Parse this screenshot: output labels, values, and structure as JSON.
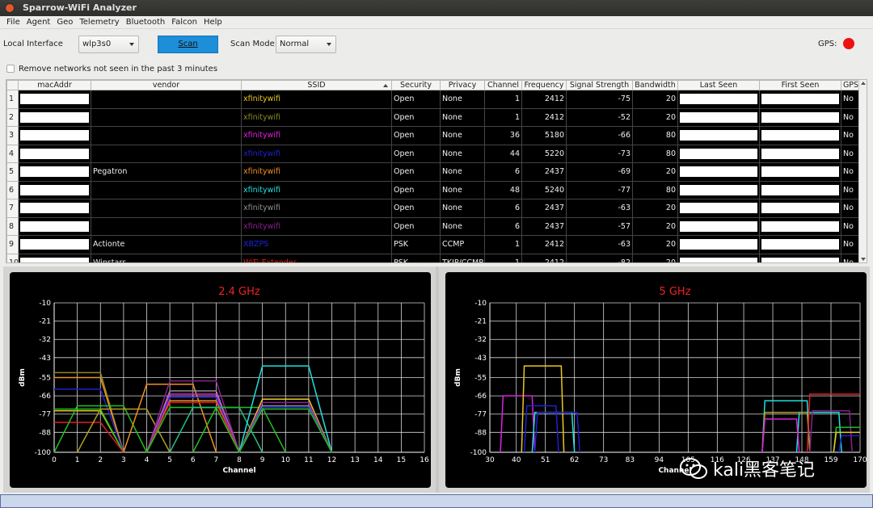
{
  "window": {
    "title": "Sparrow-WiFi Analyzer"
  },
  "menu": [
    "File",
    "Agent",
    "Geo",
    "Telemetry",
    "Bluetooth",
    "Falcon",
    "Help"
  ],
  "toolbar": {
    "local_interface_label": "Local Interface",
    "interface_value": "wlp3s0",
    "scan_label": "Scan",
    "scan_mode_label": "Scan Mode:",
    "scan_mode_value": "Normal",
    "gps_label": "GPS:",
    "gps_status_color": "#ee1111"
  },
  "filter": {
    "label": "Remove networks not seen in the past 3 minutes",
    "checked": false
  },
  "table": {
    "columns": [
      "",
      "macAddr",
      "vendor",
      "SSID",
      "Security",
      "Privacy",
      "Channel",
      "Frequency",
      "Signal Strength",
      "Bandwidth",
      "Last Seen",
      "First Seen",
      "GPS"
    ],
    "rows": [
      {
        "n": "1",
        "vendor": "",
        "ssid": "xfinitywifi",
        "ssid_color": "#e8c820",
        "security": "Open",
        "privacy": "None",
        "channel": "1",
        "frequency": "2412",
        "signal": "-75",
        "bandwidth": "20",
        "gps": "No"
      },
      {
        "n": "2",
        "vendor": "",
        "ssid": "xfinitywifi",
        "ssid_color": "#8a8a20",
        "security": "Open",
        "privacy": "None",
        "channel": "1",
        "frequency": "2412",
        "signal": "-52",
        "bandwidth": "20",
        "gps": "No"
      },
      {
        "n": "3",
        "vendor": "",
        "ssid": "xfinitywifi",
        "ssid_color": "#e020e0",
        "security": "Open",
        "privacy": "None",
        "channel": "36",
        "frequency": "5180",
        "signal": "-66",
        "bandwidth": "80",
        "gps": "No"
      },
      {
        "n": "4",
        "vendor": "",
        "ssid": "xfinitywifi",
        "ssid_color": "#2020d0",
        "security": "Open",
        "privacy": "None",
        "channel": "44",
        "frequency": "5220",
        "signal": "-73",
        "bandwidth": "80",
        "gps": "No"
      },
      {
        "n": "5",
        "vendor": "Pegatron",
        "ssid": "xfinitywifi",
        "ssid_color": "#f09020",
        "security": "Open",
        "privacy": "None",
        "channel": "6",
        "frequency": "2437",
        "signal": "-69",
        "bandwidth": "20",
        "gps": "No"
      },
      {
        "n": "6",
        "vendor": "",
        "ssid": "xfinitywifi",
        "ssid_color": "#20e0e0",
        "security": "Open",
        "privacy": "None",
        "channel": "48",
        "frequency": "5240",
        "signal": "-77",
        "bandwidth": "80",
        "gps": "No"
      },
      {
        "n": "7",
        "vendor": "",
        "ssid": "xfinitywifi",
        "ssid_color": "#909090",
        "security": "Open",
        "privacy": "None",
        "channel": "6",
        "frequency": "2437",
        "signal": "-63",
        "bandwidth": "20",
        "gps": "No"
      },
      {
        "n": "8",
        "vendor": "",
        "ssid": "xfinitywifi",
        "ssid_color": "#8a2090",
        "security": "Open",
        "privacy": "None",
        "channel": "6",
        "frequency": "2437",
        "signal": "-57",
        "bandwidth": "20",
        "gps": "No"
      },
      {
        "n": "9",
        "vendor": "Actionte",
        "ssid": "XBZPS",
        "ssid_color": "#2020e0",
        "security": "PSK",
        "privacy": "CCMP",
        "channel": "1",
        "frequency": "2412",
        "signal": "-63",
        "bandwidth": "20",
        "gps": "No"
      },
      {
        "n": "10",
        "vendor": "Winstars",
        "ssid": "WiFi-Extender",
        "ssid_color": "#e02020",
        "security": "PSK",
        "privacy": "TKIP/CCMP",
        "channel": "1",
        "frequency": "2412",
        "signal": "-82",
        "bandwidth": "20",
        "gps": "No"
      }
    ]
  },
  "chart_data": [
    {
      "type": "line",
      "title": "2.4 GHz",
      "xlabel": "Channel",
      "ylabel": "dBm",
      "xlim": [
        0,
        16
      ],
      "ylim": [
        -100,
        -10
      ],
      "xticks": [
        0,
        1,
        2,
        3,
        4,
        5,
        6,
        7,
        8,
        9,
        10,
        11,
        12,
        13,
        14,
        15,
        16
      ],
      "yticks": [
        -10,
        -21,
        -32,
        -43,
        -55,
        -66,
        -77,
        -88,
        -100
      ],
      "series": [
        {
          "color": "#e8c820",
          "x": [
            -1,
            0,
            2,
            3
          ],
          "y": [
            -100,
            -75,
            -75,
            -100
          ]
        },
        {
          "color": "#8a8a20",
          "x": [
            -1,
            0,
            2,
            3
          ],
          "y": [
            -100,
            -52,
            -52,
            -100
          ]
        },
        {
          "color": "#f09020",
          "x": [
            -1,
            0,
            2,
            3
          ],
          "y": [
            -100,
            -55,
            -55,
            -100
          ]
        },
        {
          "color": "#2020d0",
          "x": [
            -1,
            0,
            2,
            3
          ],
          "y": [
            -100,
            -62,
            -62,
            -100
          ]
        },
        {
          "color": "#20c020",
          "x": [
            -1,
            0,
            2,
            3
          ],
          "y": [
            -100,
            -74,
            -74,
            -100
          ]
        },
        {
          "color": "#e02020",
          "x": [
            -1,
            0,
            2,
            3
          ],
          "y": [
            -100,
            -82,
            -82,
            -100
          ]
        },
        {
          "color": "#20c020",
          "x": [
            0,
            1,
            3,
            4
          ],
          "y": [
            -100,
            -72,
            -72,
            -100
          ]
        },
        {
          "color": "#b0a020",
          "x": [
            1,
            2,
            4,
            5
          ],
          "y": [
            -100,
            -74,
            -74,
            -100
          ]
        },
        {
          "color": "#f09020",
          "x": [
            3,
            4,
            6,
            7
          ],
          "y": [
            -100,
            -59,
            -59,
            -100
          ]
        },
        {
          "color": "#8a2090",
          "x": [
            4,
            5,
            7,
            8
          ],
          "y": [
            -100,
            -57,
            -57,
            -100
          ]
        },
        {
          "color": "#909090",
          "x": [
            4,
            5,
            7,
            8
          ],
          "y": [
            -100,
            -63,
            -63,
            -100
          ]
        },
        {
          "color": "#e020e0",
          "x": [
            4,
            5,
            7,
            8
          ],
          "y": [
            -100,
            -65,
            -65,
            -100
          ]
        },
        {
          "color": "#2020d0",
          "x": [
            4,
            5,
            7,
            8
          ],
          "y": [
            -100,
            -67,
            -67,
            -100
          ]
        },
        {
          "color": "#f09020",
          "x": [
            4,
            5,
            7,
            8
          ],
          "y": [
            -100,
            -69,
            -69,
            -100
          ]
        },
        {
          "color": "#e02020",
          "x": [
            4,
            5,
            7,
            8
          ],
          "y": [
            -100,
            -70,
            -70,
            -100
          ]
        },
        {
          "color": "#20c020",
          "x": [
            4,
            5,
            7,
            8
          ],
          "y": [
            -100,
            -73,
            -73,
            -100
          ]
        },
        {
          "color": "#20c080",
          "x": [
            5,
            6,
            8,
            9
          ],
          "y": [
            -100,
            -73,
            -73,
            -100
          ]
        },
        {
          "color": "#20c020",
          "x": [
            6,
            7,
            9,
            10
          ],
          "y": [
            -100,
            -73,
            -73,
            -100
          ]
        },
        {
          "color": "#20e0e0",
          "x": [
            8,
            9,
            11,
            12
          ],
          "y": [
            -100,
            -48,
            -48,
            -100
          ]
        },
        {
          "color": "#e8c820",
          "x": [
            8,
            9,
            11,
            12
          ],
          "y": [
            -100,
            -68,
            -68,
            -100
          ]
        },
        {
          "color": "#8a2090",
          "x": [
            8,
            9,
            11,
            12
          ],
          "y": [
            -100,
            -70,
            -70,
            -100
          ]
        },
        {
          "color": "#909090",
          "x": [
            8,
            9,
            11,
            12
          ],
          "y": [
            -100,
            -72,
            -72,
            -100
          ]
        },
        {
          "color": "#2020d0",
          "x": [
            8,
            9,
            11,
            12
          ],
          "y": [
            -100,
            -73,
            -73,
            -100
          ]
        },
        {
          "color": "#20c020",
          "x": [
            8,
            9,
            11,
            12
          ],
          "y": [
            -100,
            -74,
            -74,
            -100
          ]
        }
      ]
    },
    {
      "type": "line",
      "title": "5 GHz",
      "xlabel": "Channel",
      "ylabel": "dBm",
      "xlim": [
        30,
        170
      ],
      "ylim": [
        -100,
        -10
      ],
      "xticks": [
        30,
        40,
        51,
        62,
        73,
        83,
        94,
        105,
        116,
        126,
        137,
        148,
        159,
        170
      ],
      "yticks": [
        -10,
        -21,
        -32,
        -43,
        -55,
        -66,
        -77,
        -88,
        -100
      ],
      "series": [
        {
          "color": "#e020e0",
          "x": [
            34,
            35,
            46,
            47
          ],
          "y": [
            -100,
            -66,
            -66,
            -100
          ]
        },
        {
          "color": "#e8c820",
          "x": [
            42,
            43,
            57,
            58
          ],
          "y": [
            -100,
            -48,
            -48,
            -100
          ]
        },
        {
          "color": "#2020d0",
          "x": [
            43,
            44,
            55,
            56
          ],
          "y": [
            -100,
            -72,
            -72,
            -100
          ]
        },
        {
          "color": "#20e0e0",
          "x": [
            46,
            47,
            61,
            62
          ],
          "y": [
            -100,
            -76,
            -76,
            -100
          ]
        },
        {
          "color": "#20e0e0",
          "x": [
            146,
            147,
            162,
            163
          ],
          "y": [
            -100,
            -76,
            -76,
            -100
          ]
        },
        {
          "color": "#2020d0",
          "x": [
            47,
            48,
            63,
            64
          ],
          "y": [
            -100,
            -76,
            -76,
            -100
          ]
        },
        {
          "color": "#20e0e0",
          "x": [
            133,
            134,
            150,
            151
          ],
          "y": [
            -100,
            -69,
            -69,
            -100
          ]
        },
        {
          "color": "#b0a020",
          "x": [
            133,
            134,
            150,
            151
          ],
          "y": [
            -100,
            -76,
            -76,
            -100
          ]
        },
        {
          "color": "#e020e0",
          "x": [
            133,
            134,
            146,
            147
          ],
          "y": [
            -100,
            -80,
            -80,
            -100
          ]
        },
        {
          "color": "#e02020",
          "x": [
            150,
            151,
            171,
            172
          ],
          "y": [
            -100,
            -65,
            -65,
            -100
          ]
        },
        {
          "color": "#8a2090",
          "x": [
            151,
            152,
            166,
            167
          ],
          "y": [
            -100,
            -75,
            -75,
            -100
          ]
        },
        {
          "color": "#20c020",
          "x": [
            160,
            161,
            171,
            172
          ],
          "y": [
            -100,
            -85,
            -85,
            -100
          ]
        },
        {
          "color": "#e8c820",
          "x": [
            160,
            161,
            171,
            172
          ],
          "y": [
            -100,
            -88,
            -88,
            -100
          ]
        },
        {
          "color": "#2020d0",
          "x": [
            162,
            163,
            171,
            172
          ],
          "y": [
            -100,
            -90,
            -90,
            -100
          ]
        }
      ]
    }
  ],
  "watermark": {
    "text": "kali黑客笔记"
  }
}
